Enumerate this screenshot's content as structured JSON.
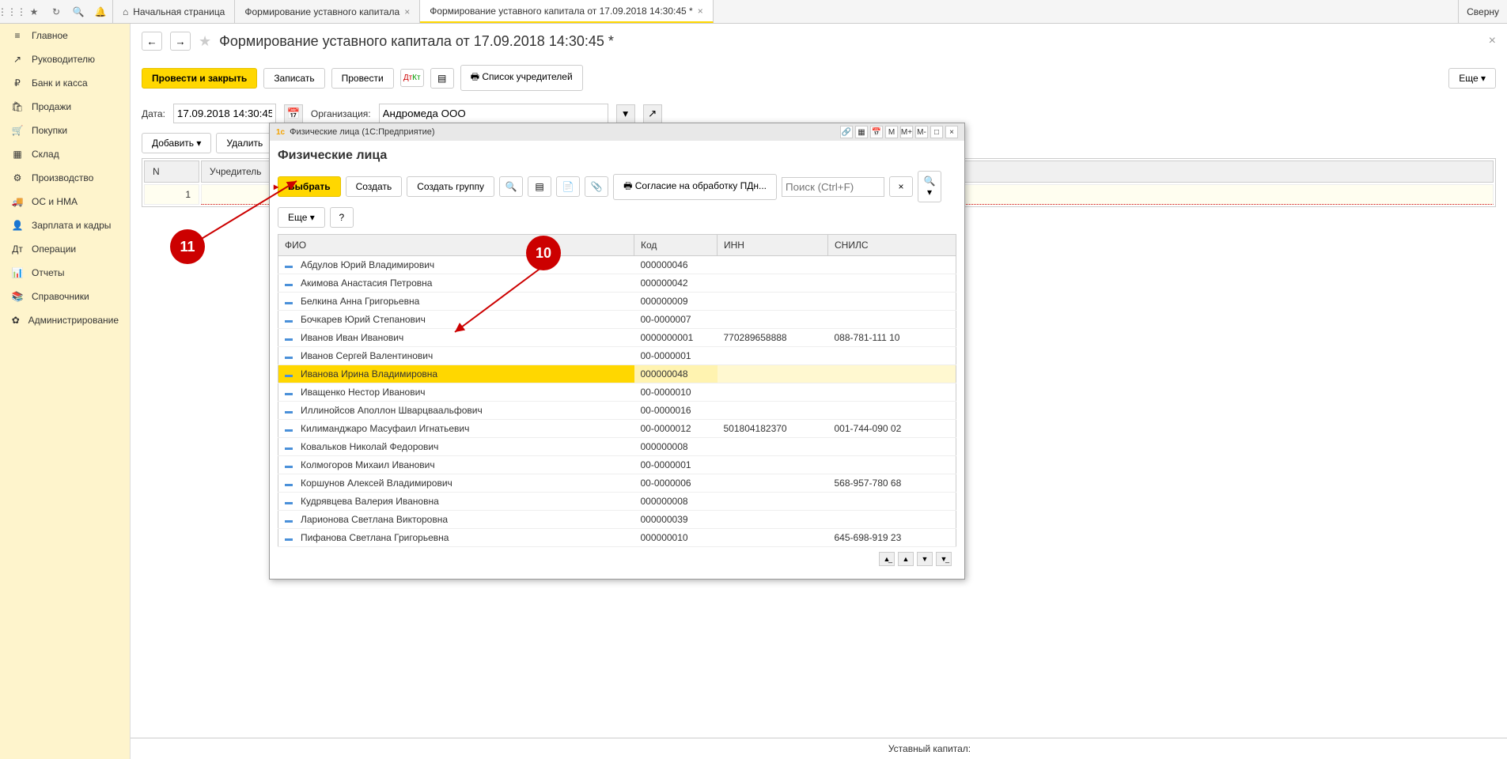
{
  "top": {
    "collapse": "Сверну",
    "tabs": [
      {
        "label": "Начальная страница",
        "closable": false
      },
      {
        "label": "Формирование уставного капитала",
        "closable": true
      },
      {
        "label": "Формирование уставного капитала от 17.09.2018 14:30:45 *",
        "closable": true,
        "active": true
      }
    ]
  },
  "sidebar": {
    "items": [
      {
        "label": "Главное",
        "icon": "≡"
      },
      {
        "label": "Руководителю",
        "icon": "↗"
      },
      {
        "label": "Банк и касса",
        "icon": "₽"
      },
      {
        "label": "Продажи",
        "icon": "🛍"
      },
      {
        "label": "Покупки",
        "icon": "🛒"
      },
      {
        "label": "Склад",
        "icon": "▦"
      },
      {
        "label": "Производство",
        "icon": "⚙"
      },
      {
        "label": "ОС и НМА",
        "icon": "🚚"
      },
      {
        "label": "Зарплата и кадры",
        "icon": "👤"
      },
      {
        "label": "Операции",
        "icon": "Дт"
      },
      {
        "label": "Отчеты",
        "icon": "📊"
      },
      {
        "label": "Справочники",
        "icon": "📚"
      },
      {
        "label": "Администрирование",
        "icon": "✿"
      }
    ]
  },
  "page": {
    "title": "Формирование уставного капитала от 17.09.2018 14:30:45 *",
    "actions": {
      "post_close": "Провести и закрыть",
      "save": "Записать",
      "post": "Провести",
      "founders_list": "Список учредителей",
      "more": "Еще"
    },
    "form": {
      "date_label": "Дата:",
      "date_value": "17.09.2018 14:30:45",
      "org_label": "Организация:",
      "org_value": "Андромеда ООО"
    },
    "table_controls": {
      "add": "Добавить",
      "delete": "Удалить"
    },
    "table": {
      "headers": {
        "n": "N",
        "founder": "Учредитель"
      },
      "rows": [
        {
          "n": "1",
          "founder": ""
        }
      ]
    },
    "footer": "Уставный капитал:"
  },
  "dialog": {
    "window_title": "Физические лица (1С:Предприятие)",
    "heading": "Физические лица",
    "toolbar": {
      "select": "Выбрать",
      "create": "Создать",
      "create_group": "Создать группу",
      "consent": "Согласие на обработку ПДн...",
      "search_placeholder": "Поиск (Ctrl+F)",
      "more": "Еще",
      "help": "?"
    },
    "columns": {
      "fio": "ФИО",
      "code": "Код",
      "inn": "ИНН",
      "snils": "СНИЛС"
    },
    "rows": [
      {
        "fio": "Абдулов Юрий Владимирович",
        "code": "000000046",
        "inn": "",
        "snils": ""
      },
      {
        "fio": "Акимова Анастасия Петровна",
        "code": "000000042",
        "inn": "",
        "snils": ""
      },
      {
        "fio": "Белкина Анна  Григорьевна",
        "code": "000000009",
        "inn": "",
        "snils": ""
      },
      {
        "fio": "Бочкарев Юрий Степанович",
        "code": "00-0000007",
        "inn": "",
        "snils": ""
      },
      {
        "fio": "Иванов Иван Иванович",
        "code": "0000000001",
        "inn": "770289658888",
        "snils": "088-781-111 10"
      },
      {
        "fio": "Иванов Сергей Валентинович",
        "code": "00-0000001",
        "inn": "",
        "snils": ""
      },
      {
        "fio": "Иванова Ирина Владимировна",
        "code": "000000048",
        "inn": "",
        "snils": "",
        "selected": true
      },
      {
        "fio": "Иващенко Нестор Иванович",
        "code": "00-0000010",
        "inn": "",
        "snils": ""
      },
      {
        "fio": "Иллинойсов Аполлон Шварцваальфович",
        "code": "00-0000016",
        "inn": "",
        "snils": ""
      },
      {
        "fio": "Килиманджаро Масуфаил Игнатьевич",
        "code": "00-0000012",
        "inn": "501804182370",
        "snils": "001-744-090 02"
      },
      {
        "fio": "Ковальков  Николай Федорович",
        "code": "000000008",
        "inn": "",
        "snils": ""
      },
      {
        "fio": "Колмогоров Михаил Иванович",
        "code": "00-0000001",
        "inn": "",
        "snils": ""
      },
      {
        "fio": "Коршунов Алексей Владимирович",
        "code": "00-0000006",
        "inn": "",
        "snils": "568-957-780 68"
      },
      {
        "fio": "Кудрявцева Валерия Ивановна",
        "code": "000000008",
        "inn": "",
        "snils": ""
      },
      {
        "fio": "Ларионова Светлана Викторовна",
        "code": "000000039",
        "inn": "",
        "snils": ""
      },
      {
        "fio": "Пифанова Светлана Григорьевна",
        "code": "000000010",
        "inn": "",
        "snils": "645-698-919 23"
      }
    ],
    "titlebar_icons": [
      "M",
      "M+",
      "M-"
    ]
  },
  "annotations": {
    "a10": "10",
    "a11": "11"
  }
}
